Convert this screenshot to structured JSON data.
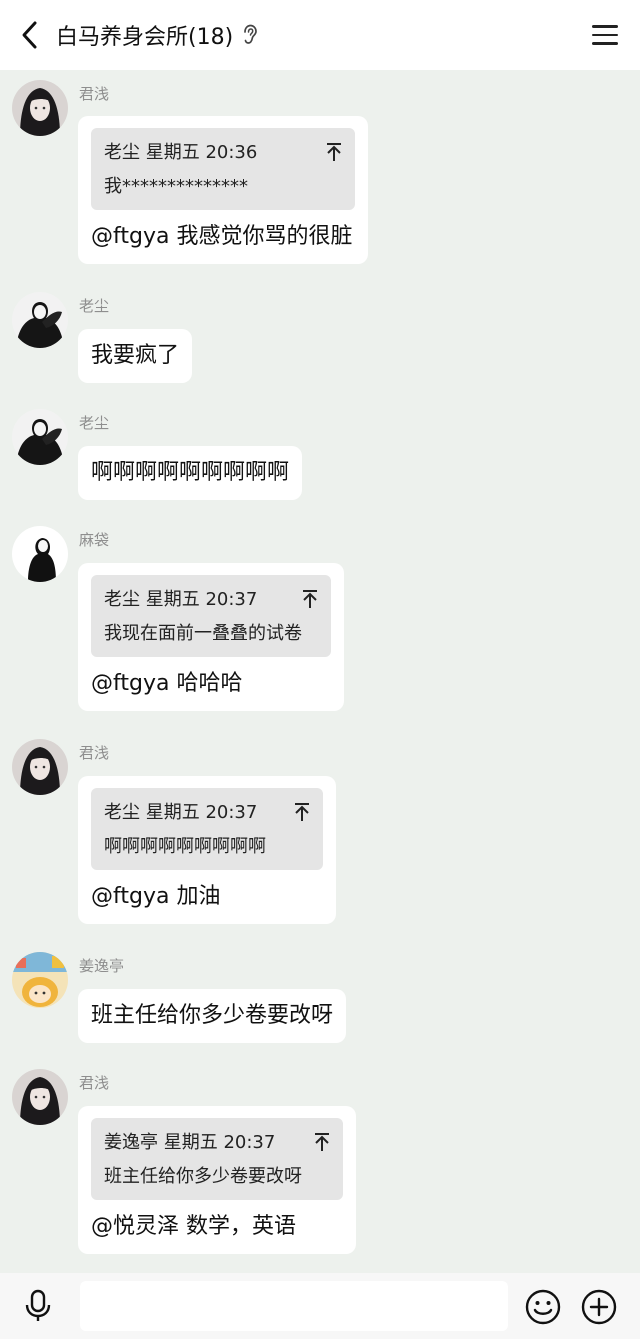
{
  "header": {
    "title": "白马养身会所(18)"
  },
  "messages": [
    {
      "sender": "君浅",
      "avatar": "avatar-junqian",
      "quote": {
        "head": "老尘 星期五 20:36",
        "body": "我**************"
      },
      "text": "@ftgya 我感觉你骂的很脏"
    },
    {
      "sender": "老尘",
      "avatar": "avatar-laochen",
      "text": "我要疯了"
    },
    {
      "sender": "老尘",
      "avatar": "avatar-laochen",
      "text": "啊啊啊啊啊啊啊啊啊"
    },
    {
      "sender": "麻袋",
      "avatar": "avatar-madai",
      "quote": {
        "head": "老尘 星期五 20:37",
        "body": "我现在面前一叠叠的试卷"
      },
      "text": "@ftgya 哈哈哈"
    },
    {
      "sender": "君浅",
      "avatar": "avatar-junqian",
      "quote": {
        "head": "老尘 星期五 20:37",
        "body": "啊啊啊啊啊啊啊啊啊"
      },
      "text": "@ftgya 加油"
    },
    {
      "sender": "姜逸亭",
      "avatar": "avatar-jiangyiting",
      "text": "班主任给你多少卷要改呀"
    },
    {
      "sender": "君浅",
      "avatar": "avatar-junqian",
      "quote": {
        "head": "姜逸亭 星期五 20:37",
        "body": "班主任给你多少卷要改呀"
      },
      "text": "@悦灵泽 数学，英语"
    }
  ],
  "input": {
    "value": "",
    "icons": [
      "voice-icon",
      "emoji-icon",
      "plus-icon"
    ]
  }
}
